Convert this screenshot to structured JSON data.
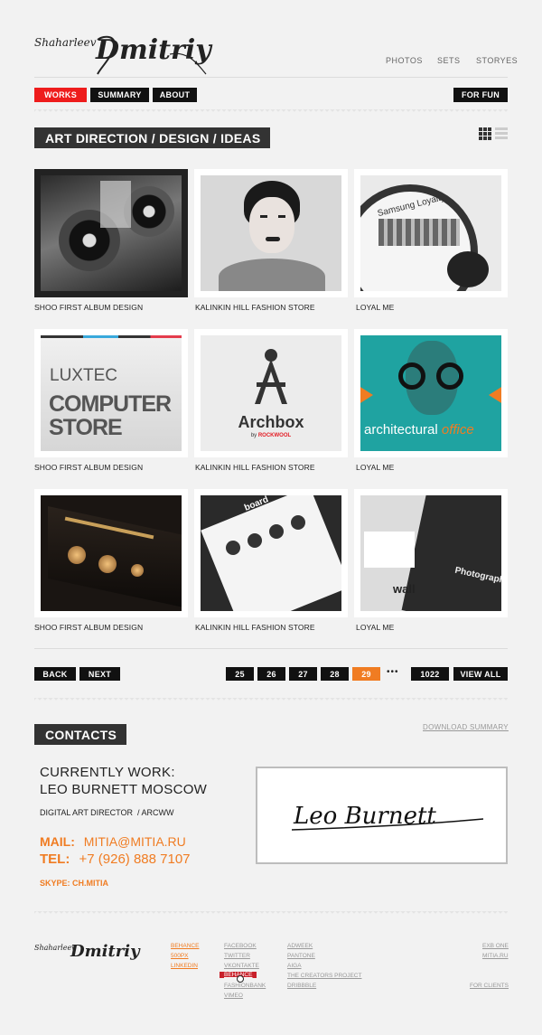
{
  "logo": {
    "first": "Shaharleev",
    "last": "Dmitriy"
  },
  "top_nav": [
    "PHOTOS",
    "SETS",
    "STORYES"
  ],
  "main_nav": {
    "works": "WORKS",
    "summary": "SUMMARY",
    "about": "ABOUT",
    "for_fun": "FOR FUN"
  },
  "works_title": "ART DIRECTION / DESIGN / IDEAS",
  "portfolio": [
    {
      "caption": "SHOO FIRST ALBUM DESIGN"
    },
    {
      "caption": "KALINKIN HILL FASHION STORE"
    },
    {
      "caption": "LOYAL ME"
    },
    {
      "caption": "SHOO FIRST ALBUM DESIGN"
    },
    {
      "caption": "KALINKIN HILL FASHION STORE"
    },
    {
      "caption": "LOYAL ME"
    },
    {
      "caption": "SHOO FIRST ALBUM DESIGN"
    },
    {
      "caption": "KALINKIN HILL FASHION STORE"
    },
    {
      "caption": "LOYAL ME"
    }
  ],
  "image_text": {
    "samsung": "Samsung Loyalty",
    "luxtec": "LUXTEC",
    "computer": "COMPUTER",
    "store": "STORE",
    "archbox": "Archbox",
    "by": "by",
    "rockwool": "ROCKWOOL",
    "arch_a": "architectural",
    "arch_b": "office",
    "board": "board",
    "wall": "wall",
    "photo": "Photography"
  },
  "pager": {
    "back": "BACK",
    "next": "NEXT",
    "pages": [
      "25",
      "26",
      "27",
      "28",
      "29"
    ],
    "current": "29",
    "ellipsis": "•••",
    "last": "1022",
    "view_all": "VIEW ALL"
  },
  "contacts": {
    "title": "CONTACTS",
    "download": "DOWNLOAD SUMMARY",
    "currently": "CURRENTLY WORK:",
    "company": "LEO BURNETT MOSCOW",
    "role": "DIGITAL ART DIRECTOR  / ARCWW",
    "mail_label": "MAIL:",
    "mail": "MITIA@MITIA.RU",
    "tel_label": "TEL:",
    "tel": "+7 (926) 888 7107",
    "skype": "SKYPE: CH.MITIA",
    "company_logo": "Leo Burnett"
  },
  "footer": {
    "col1": [
      "BEHANCE",
      "500PX",
      "LINKEDIN"
    ],
    "col2": [
      "FACEBOOK",
      "TWITTER",
      "VKONTAKTE",
      "BEHANCE",
      "FASHIONBANK",
      "VIMEO"
    ],
    "col3": [
      "ADWEEK",
      "PANTONE",
      "AIGA",
      "THE CREATORS PROJECT",
      "DRIBBBLE"
    ],
    "col4": [
      "EXB ONE",
      "MITIA.RU"
    ],
    "for_clients": "FOR CLIENTS"
  },
  "colors": {
    "accent_red": "#ee1c1c",
    "accent_orange": "#f07c22",
    "dark": "#111111",
    "background": "#f2f2f2"
  }
}
